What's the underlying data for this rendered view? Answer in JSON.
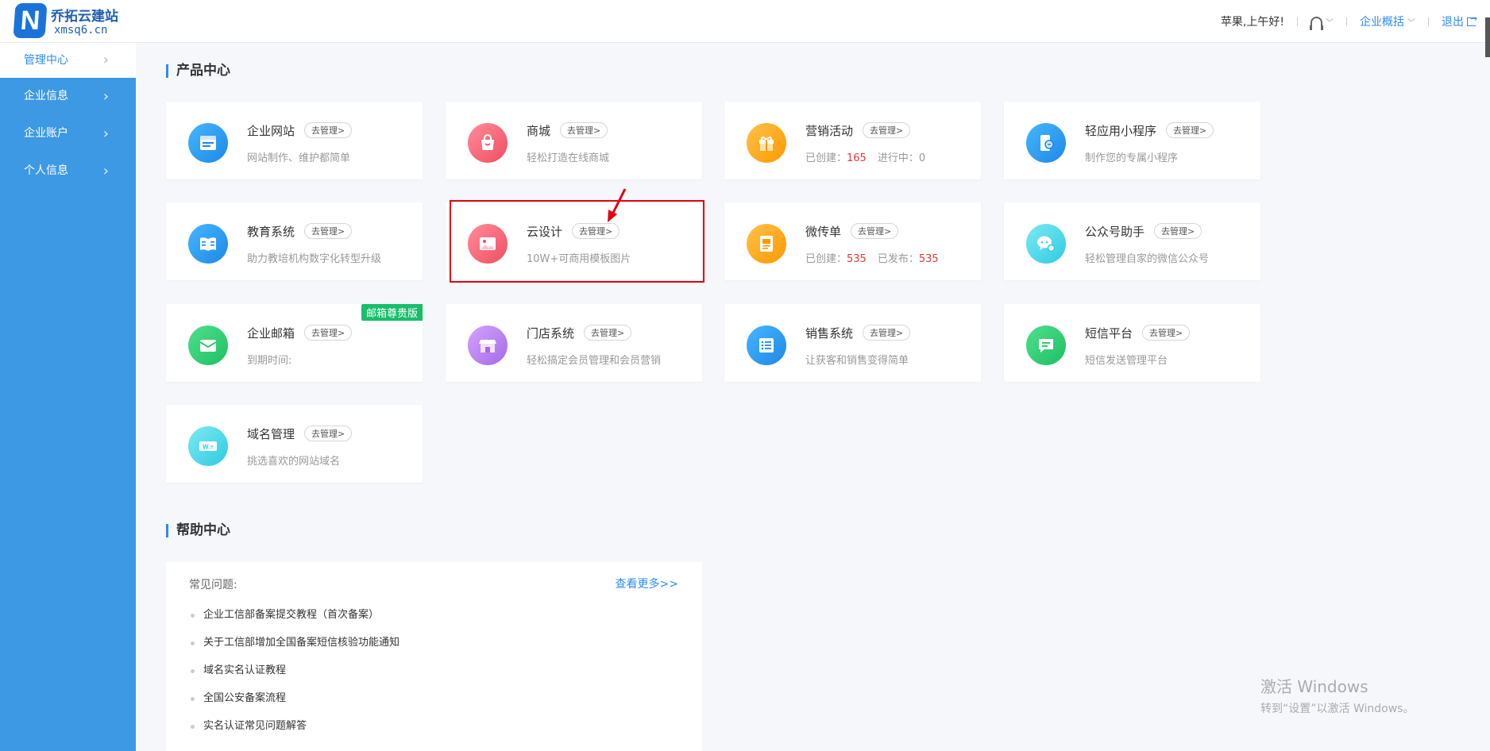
{
  "header": {
    "logo_letter": "N",
    "logo_name": "乔拓云建站",
    "logo_domain": "xmsq6.cn",
    "greeting": "苹果,上午好!",
    "overview": "企业概括",
    "logout": "退出",
    "icons": [
      "headset-icon",
      "chevron-down-icon",
      "logout-icon"
    ]
  },
  "sidebar": {
    "items": [
      {
        "label": "管理中心",
        "active": true
      },
      {
        "label": "企业信息"
      },
      {
        "label": "企业账户"
      },
      {
        "label": "个人信息"
      }
    ]
  },
  "product_center": {
    "title": "产品中心",
    "manage_label": "去管理>",
    "cards": [
      {
        "name": "企业网站",
        "desc": "网站制作、维护都简单",
        "icon": "website-icon",
        "color": "#1e88e5"
      },
      {
        "name": "商城",
        "desc": "轻松打造在线商城",
        "icon": "shopping-bag-icon",
        "color": "#f04e63"
      },
      {
        "name": "营销活动",
        "stat1_label": "已创建：",
        "stat1_value": "165",
        "stat2_label": "进行中：",
        "stat2_value": "0",
        "icon": "gift-icon",
        "color": "#ff9800"
      },
      {
        "name": "轻应用小程序",
        "desc": "制作您的专属小程序",
        "icon": "mini-program-icon",
        "color": "#1e88e5"
      },
      {
        "name": "教育系统",
        "desc": "助力教培机构数字化转型升级",
        "icon": "book-icon",
        "color": "#1e88e5"
      },
      {
        "name": "云设计",
        "desc": "10W+可商用模板图片",
        "icon": "image-icon",
        "color": "#f04e63"
      },
      {
        "name": "微传单",
        "stat1_label": "已创建：",
        "stat1_value": "535",
        "stat2_label": "已发布：",
        "stat2_value": "535",
        "icon": "flyer-icon",
        "color": "#ff9800"
      },
      {
        "name": "公众号助手",
        "desc": "轻松管理自家的微信公众号",
        "icon": "wechat-icon",
        "color": "#2dcbe0"
      },
      {
        "name": "企业邮箱",
        "desc": "到期时间:",
        "badge": "邮箱尊贵版",
        "icon": "mail-icon",
        "color": "#1fbf63"
      },
      {
        "name": "门店系统",
        "desc": "轻松搞定会员管理和会员营销",
        "icon": "store-icon",
        "color": "#a56ae6"
      },
      {
        "name": "销售系统",
        "desc": "让获客和销售变得简单",
        "icon": "list-icon",
        "color": "#1e88e5"
      },
      {
        "name": "短信平台",
        "desc": "短信发送管理平台",
        "icon": "sms-icon",
        "color": "#1fbf63"
      },
      {
        "name": "域名管理",
        "desc": "挑选喜欢的网站域名",
        "icon": "domain-icon",
        "icon_text": "W.≡",
        "color": "#2dcbe0"
      }
    ]
  },
  "help_center": {
    "title": "帮助中心",
    "faq_label": "常见问题:",
    "more_link": "查看更多>>",
    "items": [
      "企业工信部备案提交教程（首次备案）",
      "关于工信部增加全国备案短信核验功能通知",
      "域名实名认证教程",
      "全国公安备案流程",
      "实名认证常见问题解答"
    ]
  },
  "watermark": {
    "line1": "激活 Windows",
    "line2": "转到“设置”以激活 Windows。"
  }
}
